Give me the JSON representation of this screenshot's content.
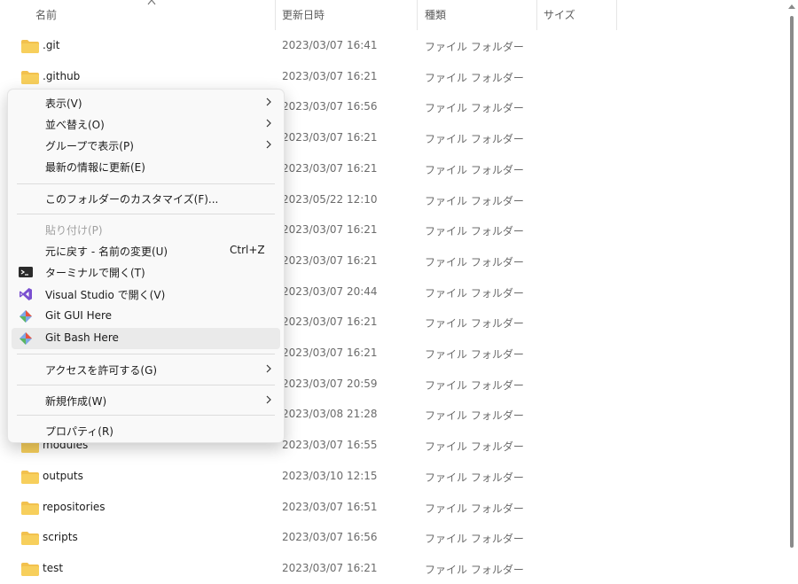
{
  "columns": {
    "name": "名前",
    "date": "更新日時",
    "type": "種類",
    "size": "サイズ"
  },
  "rows": [
    {
      "name": ".git",
      "date": "2023/03/07 16:41",
      "type": "ファイル フォルダー"
    },
    {
      "name": ".github",
      "date": "2023/03/07 16:21",
      "type": "ファイル フォルダー"
    },
    {
      "name": "",
      "date": "2023/03/07 16:56",
      "type": "ファイル フォルダー"
    },
    {
      "name": "",
      "date": "2023/03/07 16:21",
      "type": "ファイル フォルダー"
    },
    {
      "name": "",
      "date": "2023/03/07 16:21",
      "type": "ファイル フォルダー"
    },
    {
      "name": "",
      "date": "2023/05/22 12:10",
      "type": "ファイル フォルダー"
    },
    {
      "name": "",
      "date": "2023/03/07 16:21",
      "type": "ファイル フォルダー"
    },
    {
      "name": "",
      "date": "2023/03/07 16:21",
      "type": "ファイル フォルダー"
    },
    {
      "name": "",
      "date": "2023/03/07 20:44",
      "type": "ファイル フォルダー"
    },
    {
      "name": "",
      "date": "2023/03/07 16:21",
      "type": "ファイル フォルダー"
    },
    {
      "name": "",
      "date": "2023/03/07 16:21",
      "type": "ファイル フォルダー"
    },
    {
      "name": "",
      "date": "2023/03/07 20:59",
      "type": "ファイル フォルダー"
    },
    {
      "name": "",
      "date": "2023/03/08 21:28",
      "type": "ファイル フォルダー"
    },
    {
      "name": "modules",
      "date": "2023/03/07 16:55",
      "type": "ファイル フォルダー"
    },
    {
      "name": "outputs",
      "date": "2023/03/10 12:15",
      "type": "ファイル フォルダー"
    },
    {
      "name": "repositories",
      "date": "2023/03/07 16:51",
      "type": "ファイル フォルダー"
    },
    {
      "name": "scripts",
      "date": "2023/03/07 16:56",
      "type": "ファイル フォルダー"
    },
    {
      "name": "test",
      "date": "2023/03/07 16:21",
      "type": "ファイル フォルダー"
    }
  ],
  "menu": {
    "view": "表示(V)",
    "sort": "並べ替え(O)",
    "group": "グループで表示(P)",
    "refresh": "最新の情報に更新(E)",
    "customize": "このフォルダーのカスタマイズ(F)...",
    "paste": "貼り付け(P)",
    "undo": "元に戻す - 名前の変更(U)",
    "undo_shortcut": "Ctrl+Z",
    "terminal": "ターミナルで開く(T)",
    "vs": "Visual Studio で開く(V)",
    "git_gui": "Git GUI Here",
    "git_bash": "Git Bash Here",
    "access": "アクセスを許可する(G)",
    "new": "新規作成(W)",
    "properties": "プロパティ(R)"
  },
  "icons": {
    "folder": "folder-icon",
    "terminal": "terminal-icon",
    "vs": "visual-studio-icon",
    "git": "git-icon",
    "submenu": "chevron-right-icon"
  },
  "colors": {
    "folder": "#f2c14e",
    "menu_bg": "#f9f9f9",
    "hover": "#eaeaea",
    "vs": "#7a4fd0",
    "git": "#e8533e"
  }
}
